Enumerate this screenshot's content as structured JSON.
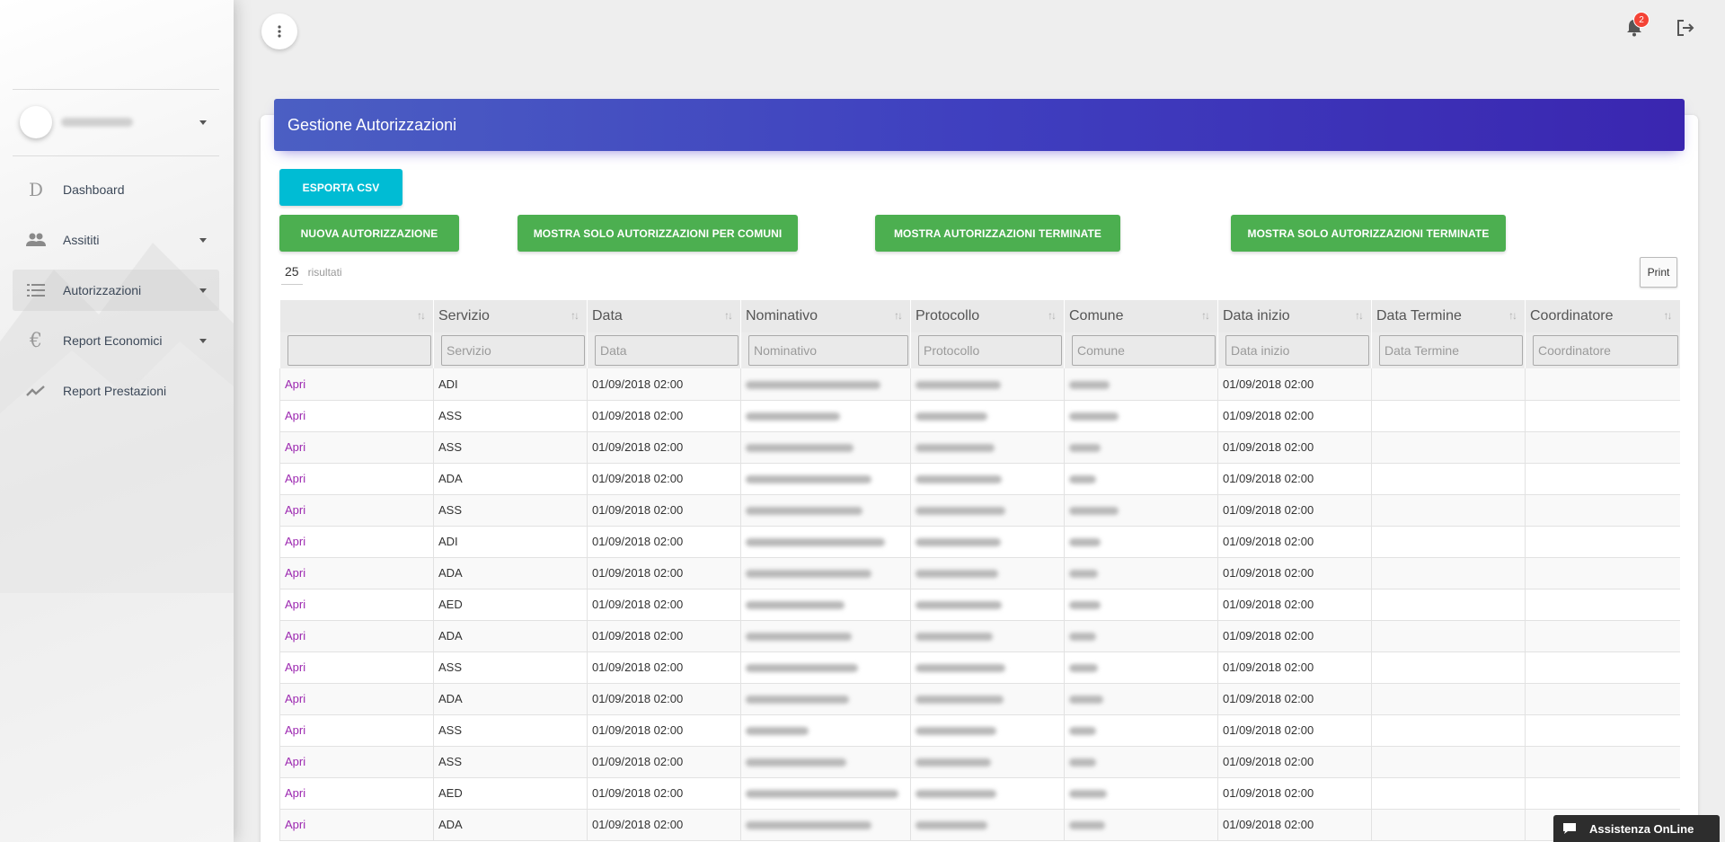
{
  "sidebar": {
    "items": [
      {
        "label": "Dashboard",
        "icon": "letter-d-icon",
        "glyph": "D"
      },
      {
        "label": "Assititi",
        "icon": "people-icon"
      },
      {
        "label": "Autorizzazioni",
        "icon": "list-icon"
      },
      {
        "label": "Report Economici",
        "icon": "euro-icon",
        "glyph": "€"
      },
      {
        "label": "Report Prestazioni",
        "icon": "trending-icon"
      }
    ]
  },
  "topbar": {
    "notification_count": "2"
  },
  "card": {
    "title": "Gestione Autorizzazioni",
    "buttons": {
      "export_csv": "ESPORTA CSV",
      "new_auth": "NUOVA AUTORIZZAZIONE",
      "only_comuni": "MOSTRA SOLO AUTORIZZAZIONI PER COMUNI",
      "show_ended": "MOSTRA AUTORIZZAZIONI TERMINATE",
      "only_ended": "MOSTRA SOLO AUTORIZZAZIONI TERMINATE",
      "print": "Print"
    },
    "page_length": "25",
    "page_length_label": "risultati"
  },
  "table": {
    "headers": [
      "",
      "Servizio",
      "Data",
      "Nominativo",
      "Protocollo",
      "Comune",
      "Data inizio",
      "Data Termine",
      "Coordinatore"
    ],
    "filter_placeholders": [
      "",
      "Servizio",
      "Data",
      "Nominativo",
      "Protocollo",
      "Comune",
      "Data inizio",
      "Data Termine",
      "Coordinatore"
    ],
    "rows": [
      {
        "action": "Apri",
        "servizio": "ADI",
        "data": "01/09/2018 02:00",
        "data_inizio": "01/09/2018 02:00"
      },
      {
        "action": "Apri",
        "servizio": "ASS",
        "data": "01/09/2018 02:00",
        "data_inizio": "01/09/2018 02:00"
      },
      {
        "action": "Apri",
        "servizio": "ASS",
        "data": "01/09/2018 02:00",
        "data_inizio": "01/09/2018 02:00"
      },
      {
        "action": "Apri",
        "servizio": "ADA",
        "data": "01/09/2018 02:00",
        "data_inizio": "01/09/2018 02:00"
      },
      {
        "action": "Apri",
        "servizio": "ASS",
        "data": "01/09/2018 02:00",
        "data_inizio": "01/09/2018 02:00"
      },
      {
        "action": "Apri",
        "servizio": "ADI",
        "data": "01/09/2018 02:00",
        "data_inizio": "01/09/2018 02:00"
      },
      {
        "action": "Apri",
        "servizio": "ADA",
        "data": "01/09/2018 02:00",
        "data_inizio": "01/09/2018 02:00"
      },
      {
        "action": "Apri",
        "servizio": "AED",
        "data": "01/09/2018 02:00",
        "data_inizio": "01/09/2018 02:00"
      },
      {
        "action": "Apri",
        "servizio": "ADA",
        "data": "01/09/2018 02:00",
        "data_inizio": "01/09/2018 02:00"
      },
      {
        "action": "Apri",
        "servizio": "ASS",
        "data": "01/09/2018 02:00",
        "data_inizio": "01/09/2018 02:00"
      },
      {
        "action": "Apri",
        "servizio": "ADA",
        "data": "01/09/2018 02:00",
        "data_inizio": "01/09/2018 02:00"
      },
      {
        "action": "Apri",
        "servizio": "ASS",
        "data": "01/09/2018 02:00",
        "data_inizio": "01/09/2018 02:00"
      },
      {
        "action": "Apri",
        "servizio": "ASS",
        "data": "01/09/2018 02:00",
        "data_inizio": "01/09/2018 02:00"
      },
      {
        "action": "Apri",
        "servizio": "AED",
        "data": "01/09/2018 02:00",
        "data_inizio": "01/09/2018 02:00"
      },
      {
        "action": "Apri",
        "servizio": "ADA",
        "data": "01/09/2018 02:00",
        "data_inizio": "01/09/2018 02:00"
      }
    ]
  },
  "chat": {
    "label": "Assistenza OnLine",
    "icon": "chat-bubble-icon"
  },
  "colors": {
    "header_gradient_start": "#4b5fc3",
    "header_gradient_end": "#3a26b0",
    "btn_info": "#00bcd4",
    "btn_success": "#4caf50",
    "link": "#9c27b0",
    "badge": "#f44336"
  }
}
